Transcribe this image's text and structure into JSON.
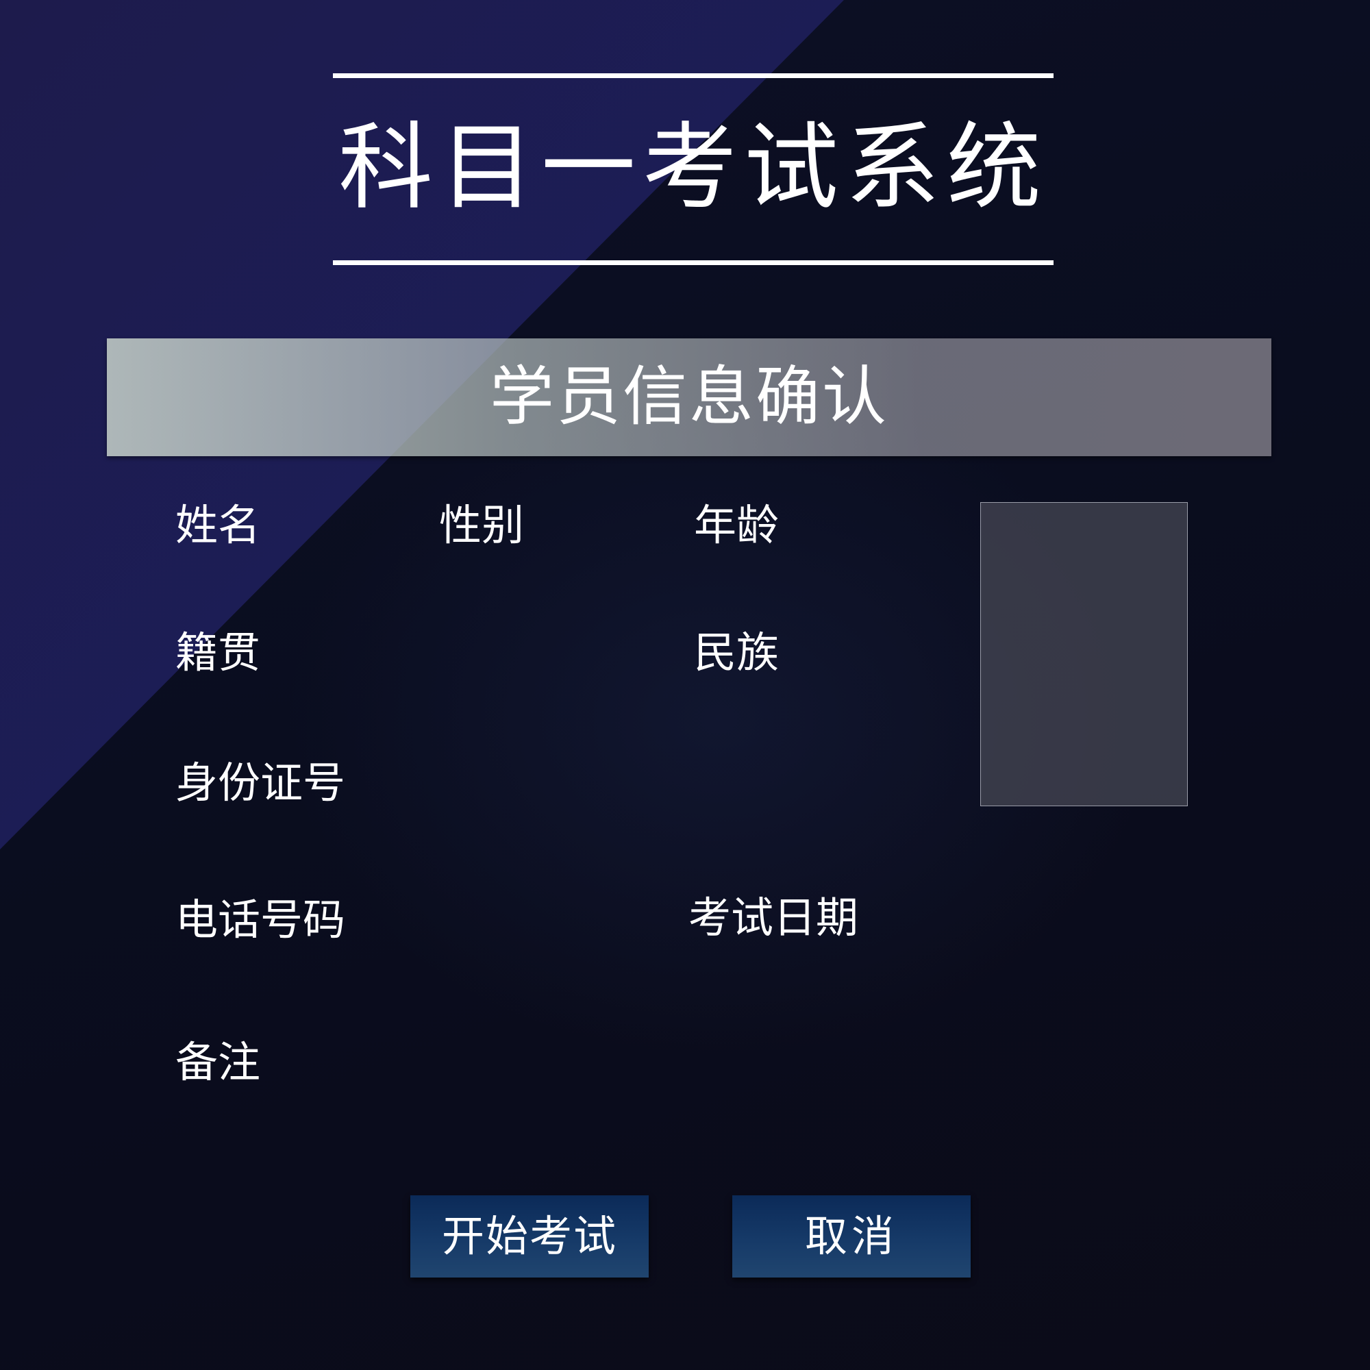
{
  "header": {
    "title": "科目一考试系统"
  },
  "banner": {
    "title": "学员信息确认"
  },
  "fields": {
    "name_label": "姓名",
    "gender_label": "性别",
    "age_label": "年龄",
    "native_place_label": "籍贯",
    "ethnicity_label": "民族",
    "id_number_label": "身份证号",
    "phone_label": "电话号码",
    "exam_date_label": "考试日期",
    "remarks_label": "备注"
  },
  "actions": {
    "start_label": "开始考试",
    "cancel_label": "取消"
  },
  "colors": {
    "diagonal_panel": "#1e1e55",
    "banner": "#9aa0a0",
    "button": "#163a68",
    "text": "#ffffff"
  }
}
